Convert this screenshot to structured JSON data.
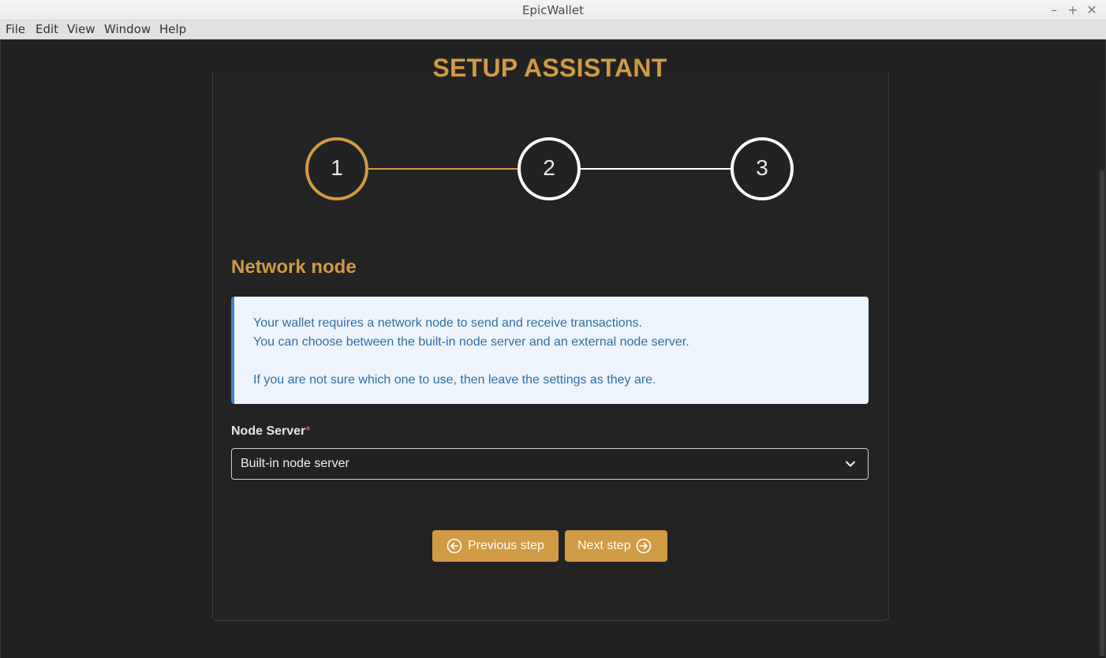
{
  "window": {
    "title": "EpicWallet",
    "controls": {
      "minimize": "–",
      "maximize": "+",
      "close": "✕"
    }
  },
  "menubar": {
    "items": [
      "File",
      "Edit",
      "View",
      "Window",
      "Help"
    ]
  },
  "page": {
    "title": "SETUP ASSISTANT"
  },
  "stepper": {
    "steps": [
      "1",
      "2",
      "3"
    ],
    "active_step": 1,
    "colors": {
      "active": "#d19a44",
      "inactive": "#ffffff"
    }
  },
  "section": {
    "title": "Network node",
    "info": {
      "line1": "Your wallet requires a network node to send and receive transactions.",
      "line2": "You can choose between the built-in node server and an external node server.",
      "line3": "If you are not sure which one to use, then leave the settings as they are."
    }
  },
  "node_server": {
    "label": "Node Server",
    "required_mark": "*",
    "selected": "Built-in node server",
    "icon": "chevron-down-icon"
  },
  "buttons": {
    "previous": {
      "label": "Previous step",
      "icon": "arrow-left-circle-icon"
    },
    "next": {
      "label": "Next step",
      "icon": "arrow-right-circle-icon"
    }
  },
  "colors": {
    "accent": "#d19a44",
    "background": "#222222",
    "info_background": "#eef4fb",
    "info_border": "#3b85c6",
    "info_text": "#2f6ea8",
    "required": "#e0434b"
  }
}
